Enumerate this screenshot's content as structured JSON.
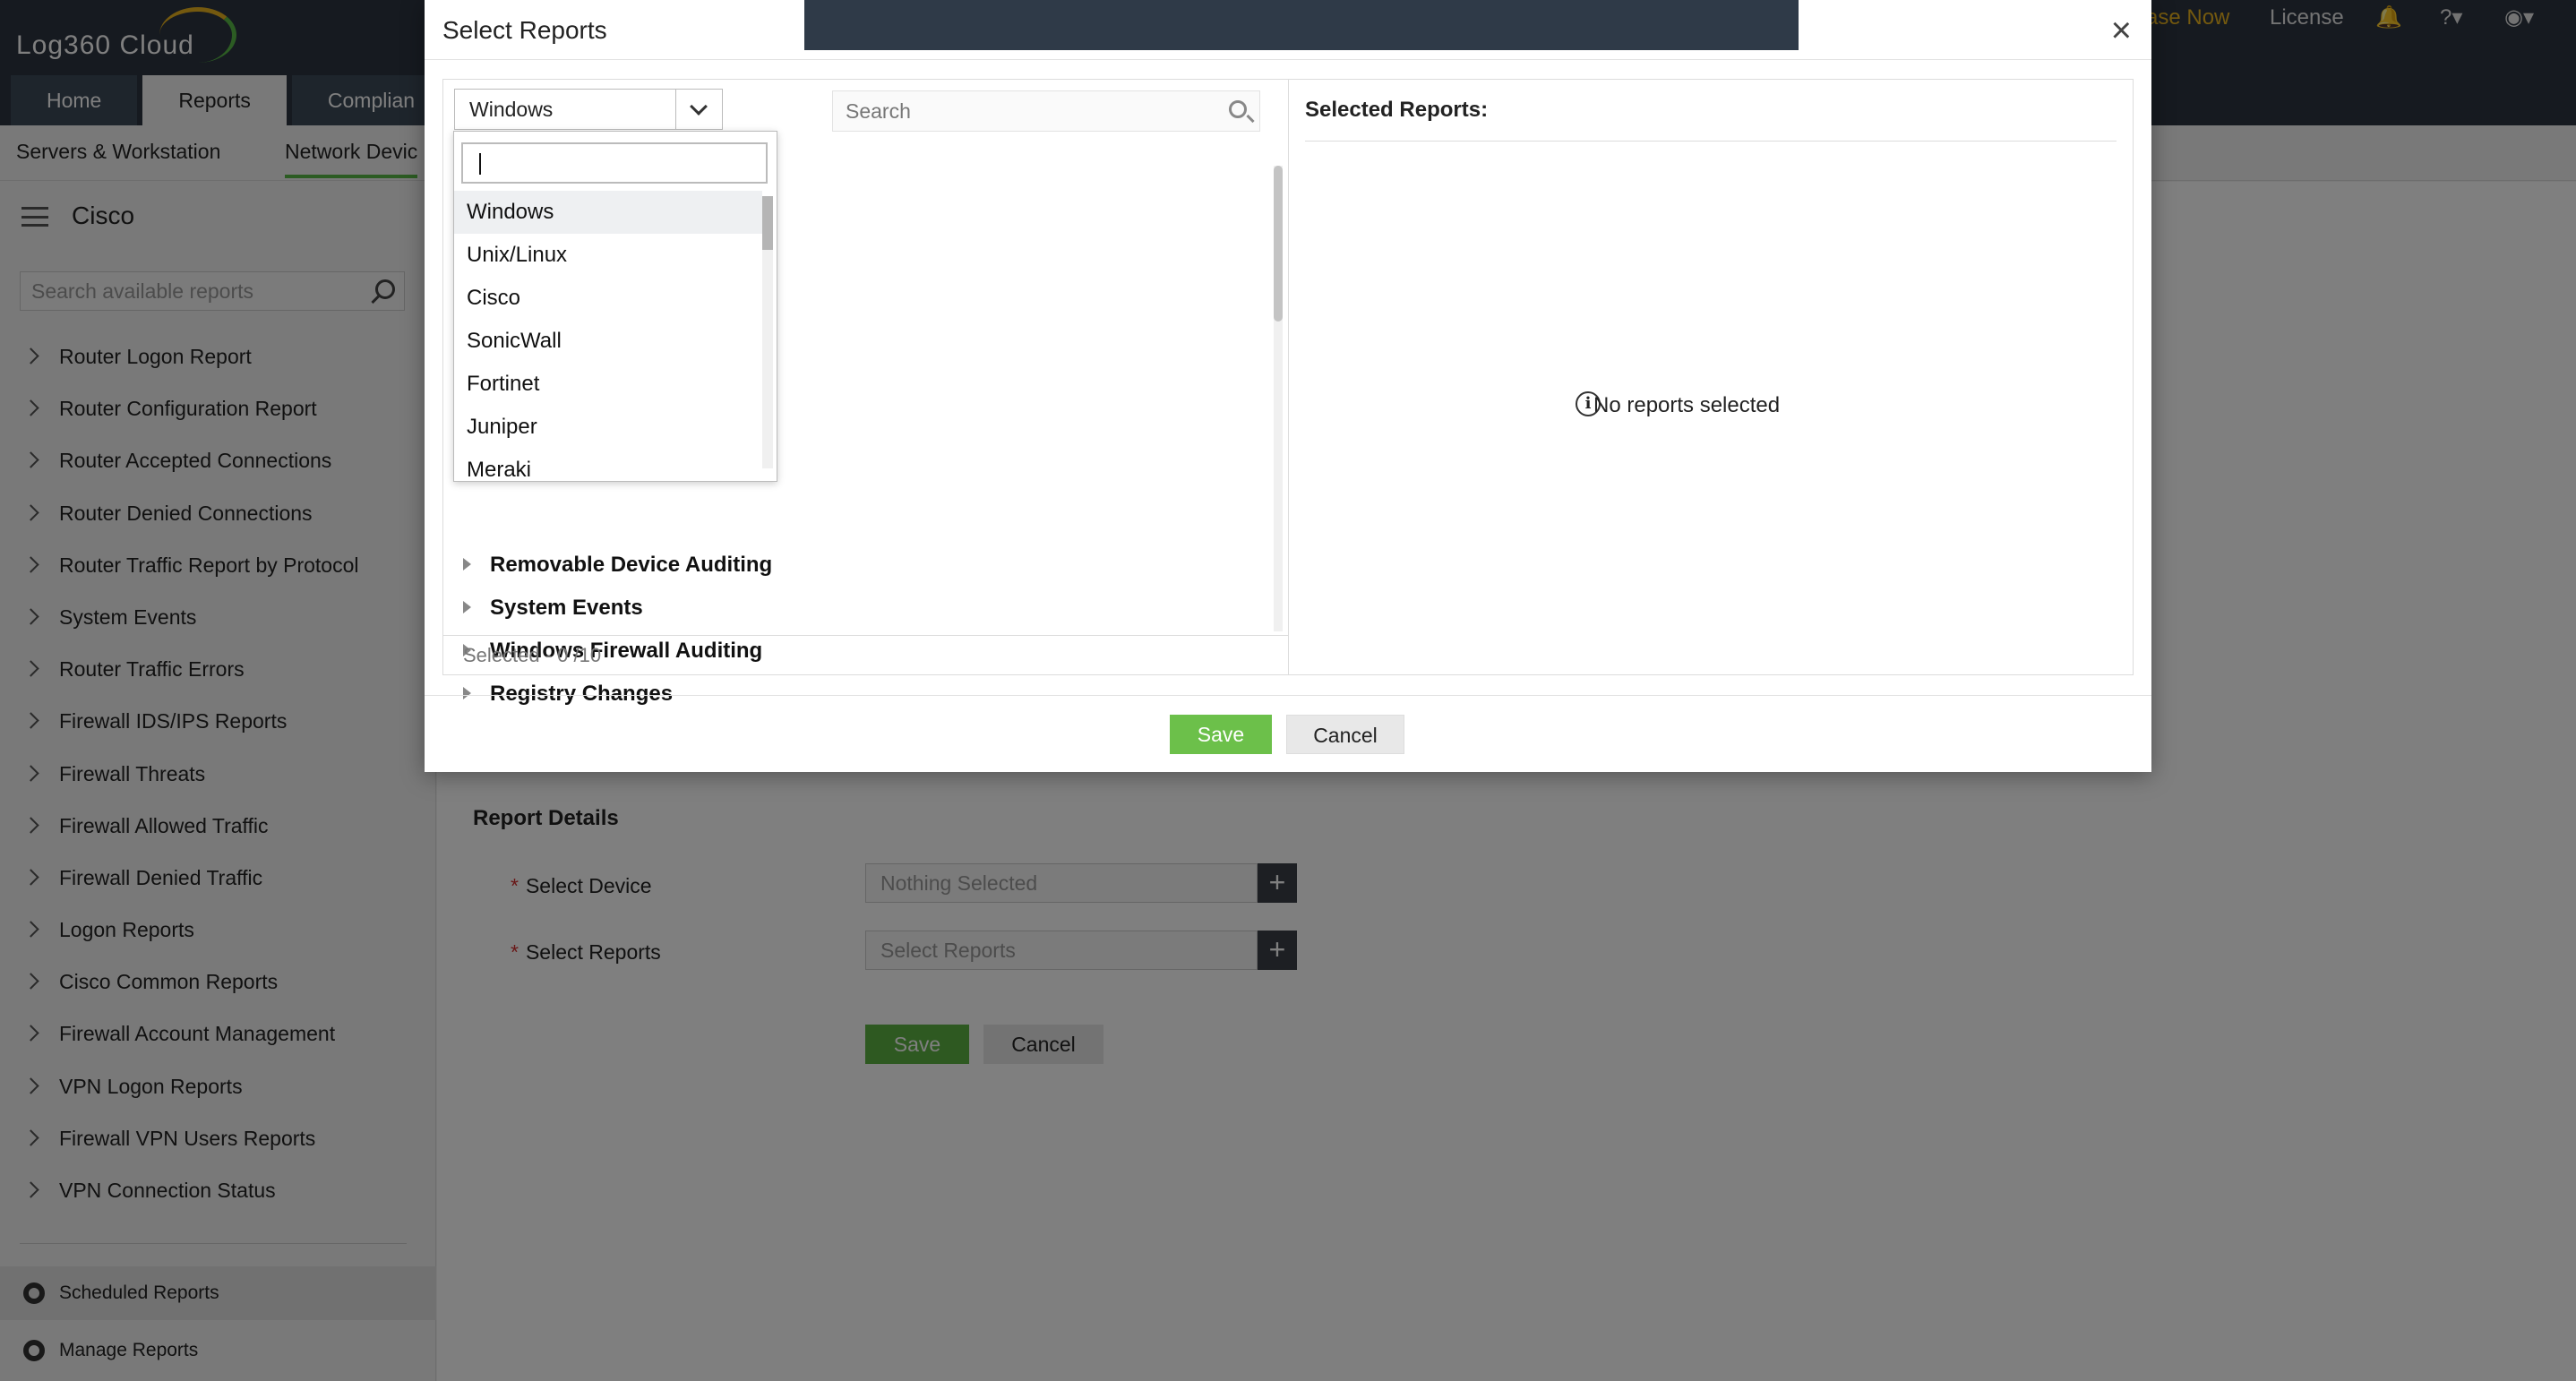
{
  "app": {
    "brand": "Log360 Cloud"
  },
  "header": {
    "purchase_link": "ase Now",
    "license": "License",
    "tabs": [
      "Home",
      "Reports",
      "Complian"
    ]
  },
  "subnav": {
    "items": [
      "Servers & Workstation",
      "Network Devic"
    ]
  },
  "sidebar": {
    "title": "Cisco",
    "search_placeholder": "Search available reports",
    "items": [
      "Router Logon Report",
      "Router Configuration Report",
      "Router Accepted Connections",
      "Router Denied Connections",
      "Router Traffic Report by Protocol",
      "System Events",
      "Router Traffic Errors",
      "Firewall IDS/IPS Reports",
      "Firewall Threats",
      "Firewall Allowed Traffic",
      "Firewall Denied Traffic",
      "Logon Reports",
      "Cisco Common Reports",
      "Firewall Account Management",
      "VPN Logon Reports",
      "Firewall VPN Users Reports",
      "VPN Connection Status"
    ],
    "bottom": [
      "Scheduled Reports",
      "Manage Reports"
    ]
  },
  "form": {
    "title": "Report Details",
    "device_label": "Select Device",
    "device_placeholder": "Nothing Selected",
    "reports_label": "Select Reports",
    "reports_placeholder": "Select Reports",
    "save": "Save",
    "cancel": "Cancel"
  },
  "modal": {
    "title": "Select Reports",
    "close": "×",
    "platform_selected": "Windows",
    "search_placeholder": "Search",
    "tree_items": [
      "Removable Device Auditing",
      "System Events",
      "Windows Firewall Auditing",
      "Registry Changes"
    ],
    "selected_count": "Selected - 0 /10",
    "selected_title": "Selected Reports:",
    "empty_message": "No reports selected",
    "save": "Save",
    "cancel": "Cancel"
  },
  "dropdown": {
    "options": [
      "Windows",
      "Unix/Linux",
      "Cisco",
      "SonicWall",
      "Fortinet",
      "Juniper",
      "Meraki"
    ]
  },
  "colors": {
    "accent": "#5cb342",
    "header": "#2c3440",
    "required": "#d32f2f"
  }
}
